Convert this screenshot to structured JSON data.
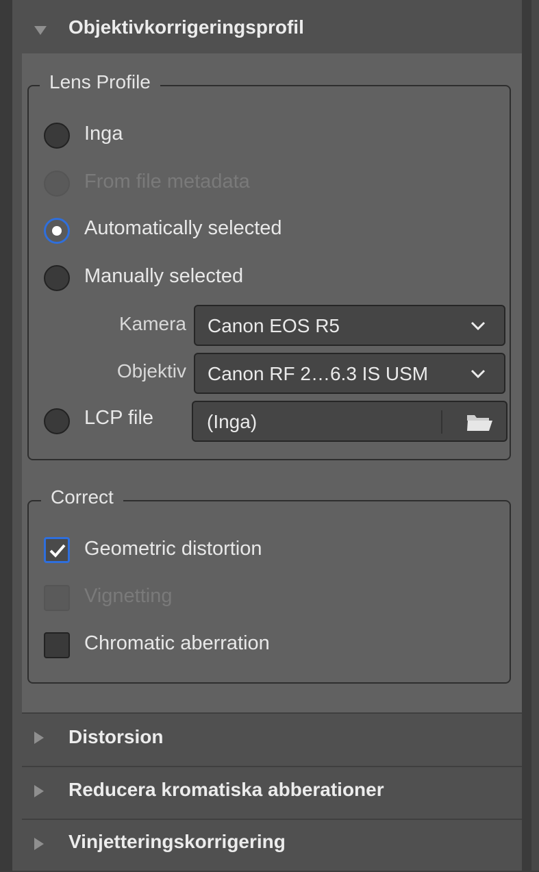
{
  "lens_profile_section": {
    "title": "Objektivkorrigeringsprofil",
    "lens_profile_group": {
      "legend": "Lens Profile",
      "options": {
        "none": "Inga",
        "from_metadata": "From file metadata",
        "auto": "Automatically selected",
        "manual": "Manually selected",
        "lcp": "LCP file"
      },
      "selected": "auto",
      "camera": {
        "label": "Kamera",
        "value": "Canon EOS R5"
      },
      "lens": {
        "label": "Objektiv",
        "value": "Canon RF 2…6.3 IS USM"
      },
      "lcp_file": {
        "value": "(Inga)"
      }
    },
    "correct_group": {
      "legend": "Correct",
      "geometric_distortion": {
        "label": "Geometric distortion",
        "checked": true
      },
      "vignetting": {
        "label": "Vignetting",
        "checked": false,
        "disabled": true
      },
      "chromatic_aberration": {
        "label": "Chromatic aberration",
        "checked": false
      }
    }
  },
  "collapsed_sections": [
    {
      "title": "Distorsion"
    },
    {
      "title": "Reducera kromatiska abberationer"
    },
    {
      "title": "Vinjetteringskorrigering"
    }
  ],
  "colors": {
    "panel": "#505050",
    "section_body": "#616161",
    "accent": "#2f6fdc"
  }
}
